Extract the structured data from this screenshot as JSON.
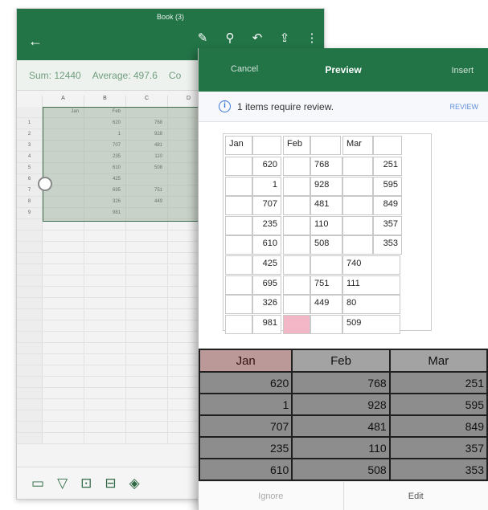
{
  "excel": {
    "book_title": "Book (3)",
    "back_icon": "back-arrow-icon",
    "toolbar_icons": [
      "draw-icon",
      "search-icon",
      "undo-icon",
      "share-icon",
      "more-icon"
    ],
    "stats": {
      "sum": "Sum: 12440",
      "average": "Average: 497.6",
      "count": "Co"
    },
    "columns": [
      "A",
      "B",
      "C",
      "D"
    ],
    "header_row": {
      "a": "Jan",
      "b": "Feb"
    },
    "rows": [
      {
        "n": "1",
        "b": "620",
        "c": "768"
      },
      {
        "n": "2",
        "b": "1",
        "c": "928"
      },
      {
        "n": "3",
        "b": "707",
        "c": "481"
      },
      {
        "n": "4",
        "b": "235",
        "c": "110"
      },
      {
        "n": "5",
        "b": "610",
        "c": "508"
      },
      {
        "n": "6",
        "b": "425",
        "c": ""
      },
      {
        "n": "7",
        "b": "695",
        "c": "751"
      },
      {
        "n": "8",
        "b": "326",
        "c": "449"
      },
      {
        "n": "9",
        "b": "981",
        "c": ""
      }
    ]
  },
  "preview": {
    "cancel_label": "Cancel",
    "title": "Preview",
    "insert_label": "Insert",
    "review_text": "1 items require review.",
    "review_link": "REVIEW",
    "grid": {
      "headers": [
        "Jan",
        "Feb",
        "Mar"
      ],
      "jan": [
        "620",
        "1",
        "707",
        "235",
        "610",
        "425",
        "695",
        "326",
        "981"
      ],
      "feb": [
        "768",
        "928",
        "481",
        "110",
        "508",
        "751",
        "449"
      ],
      "mar": [
        "251",
        "595",
        "849",
        "357",
        "353",
        "740",
        "111",
        "80",
        "509"
      ]
    },
    "photo": {
      "headers": [
        "Jan",
        "Feb",
        "Mar"
      ],
      "rows": [
        [
          "620",
          "768",
          "251"
        ],
        [
          "1",
          "928",
          "595"
        ],
        [
          "707",
          "481",
          "849"
        ],
        [
          "235",
          "110",
          "357"
        ],
        [
          "610",
          "508",
          "353"
        ]
      ]
    },
    "ignore_label": "Ignore",
    "edit_label": "Edit"
  }
}
